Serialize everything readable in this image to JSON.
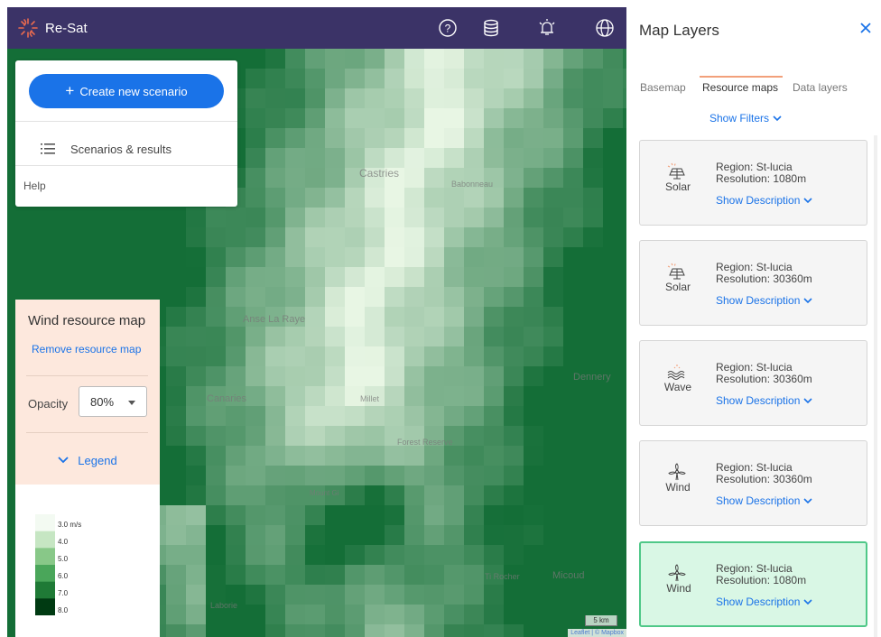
{
  "app": {
    "name": "Re-Sat",
    "brand_color": "#3b3367",
    "accent_color": "#1a73e8"
  },
  "topbar_icons": [
    "help-icon",
    "database-icon",
    "alarm-icon",
    "globe-icon"
  ],
  "menu": {
    "create_label": "Create new scenario",
    "create_icon": "+",
    "scenarios_label": "Scenarios & results",
    "help_label": "Help"
  },
  "map": {
    "labels": [
      "Castries",
      "Babonneau",
      "Anse La Raye",
      "Canaries",
      "Millet",
      "Forest Reserve",
      "Mount Gi",
      "Dennery",
      "Ti Rocher",
      "Micoud",
      "Laborie"
    ],
    "scale": "5 km",
    "attribution": "Leaflet | © Mapbox"
  },
  "wind_panel": {
    "title": "Wind resource map",
    "remove_label": "Remove resource map",
    "opacity_label": "Opacity",
    "opacity_value": "80%",
    "legend_label": "Legend",
    "legend_ticks": [
      "3.0 m/s",
      "4.0",
      "5.0",
      "6.0",
      "7.0",
      "8.0"
    ],
    "legend_colors": [
      "#f3faf2",
      "#c6e6c3",
      "#88c888",
      "#4aa65a",
      "#1f7a36",
      "#003a12"
    ]
  },
  "layers_panel": {
    "title": "Map Layers",
    "tabs": [
      "Basemap",
      "Resource maps",
      "Data layers"
    ],
    "active_tab": "Resource maps",
    "filters_label": "Show Filters",
    "cards": [
      {
        "type": "Solar",
        "icon": "solar-panel-icon",
        "region": "Region: St-lucia",
        "resolution": "Resolution: 1080m",
        "desc": "Show Description",
        "selected": false
      },
      {
        "type": "Solar",
        "icon": "solar-panel-icon",
        "region": "Region: St-lucia",
        "resolution": "Resolution: 30360m",
        "desc": "Show Description",
        "selected": false
      },
      {
        "type": "Wave",
        "icon": "wave-icon",
        "region": "Region: St-lucia",
        "resolution": "Resolution: 30360m",
        "desc": "Show Description",
        "selected": false
      },
      {
        "type": "Wind",
        "icon": "wind-turbine-icon",
        "region": "Region: St-lucia",
        "resolution": "Resolution: 30360m",
        "desc": "Show Description",
        "selected": false
      },
      {
        "type": "Wind",
        "icon": "wind-turbine-icon",
        "region": "Region: St-lucia",
        "resolution": "Resolution: 1080m",
        "desc": "Show Description",
        "selected": true
      }
    ]
  }
}
